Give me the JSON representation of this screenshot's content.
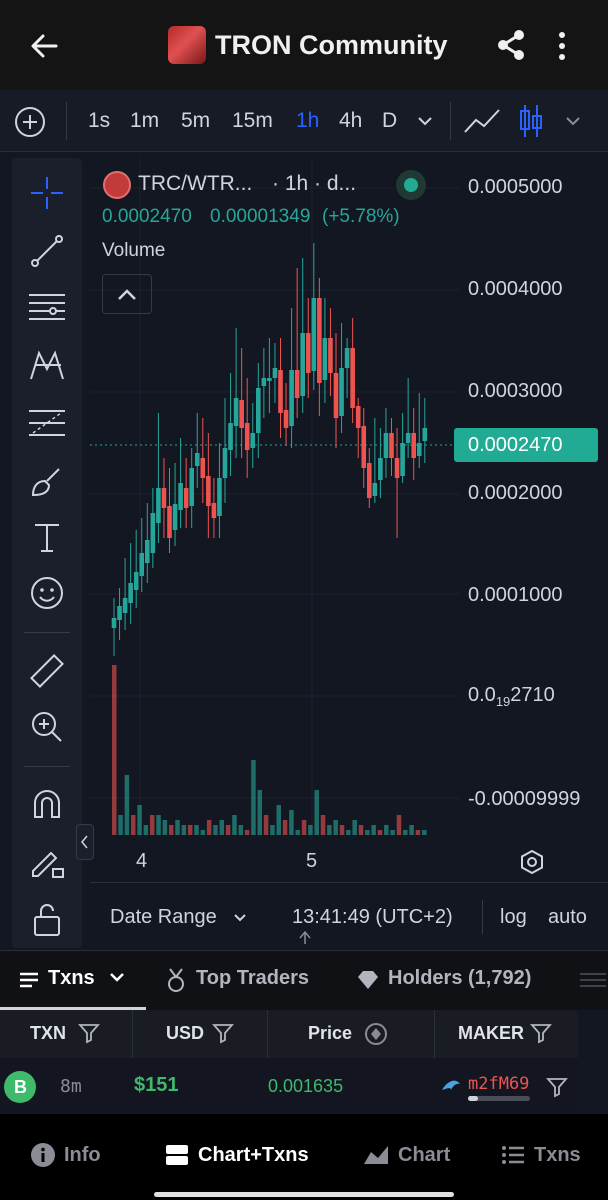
{
  "header": {
    "title": "TRON Community"
  },
  "toolbar": {
    "timeframes": [
      "1s",
      "1m",
      "5m",
      "15m",
      "1h",
      "4h",
      "D"
    ],
    "active_timeframe": "1h"
  },
  "chart": {
    "symbol": "TRC/WTR...",
    "interval_label": "· 1h · d...",
    "price": "0.0002470",
    "change": "0.00001349",
    "change_pct": "(+5.78%)",
    "volume_label": "Volume",
    "y_labels": [
      "0.0005000",
      "0.0004000",
      "0.0003000",
      "0.0002000",
      "0.0001000",
      "-0.00009999"
    ],
    "y_label_small_main": "0.0",
    "y_label_small_sub": "19",
    "y_label_small_tail": "2710",
    "current_price_tag": "0.0002470",
    "x_labels": [
      "4",
      "5"
    ],
    "date_range_label": "Date Range",
    "time_label": "13:41:49 (UTC+2)",
    "log_label": "log",
    "auto_label": "auto",
    "colors": {
      "up": "#26a69a",
      "down": "#ef5350",
      "accent": "#2962ff",
      "tag_bg": "#22ab94"
    }
  },
  "tabs": {
    "txns": "Txns",
    "top_traders": "Top Traders",
    "holders": "Holders (1,792)"
  },
  "table": {
    "headers": [
      "TXN",
      "USD",
      "Price",
      "MAKER"
    ],
    "row": {
      "type": "B",
      "age": "8m",
      "usd": "$151",
      "price": "0.001635",
      "maker": "m2fM69"
    }
  },
  "bottom_nav": {
    "info": "Info",
    "chart_txns": "Chart+Txns",
    "chart": "Chart",
    "txns": "Txns"
  }
}
